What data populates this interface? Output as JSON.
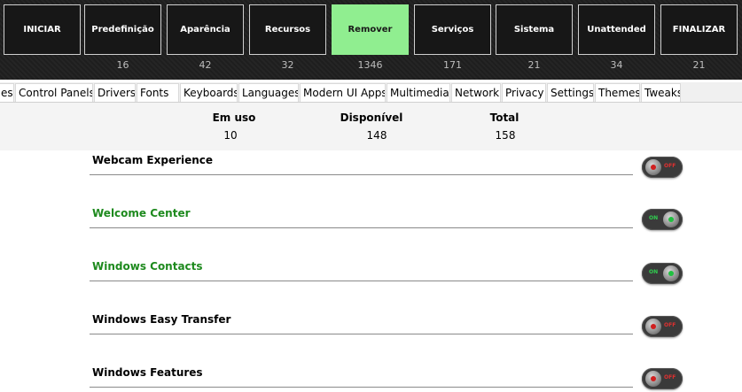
{
  "nav": [
    {
      "label": "INICIAR",
      "count": ""
    },
    {
      "label": "Predefinição",
      "count": "16"
    },
    {
      "label": "Aparência",
      "count": "42"
    },
    {
      "label": "Recursos",
      "count": "32"
    },
    {
      "label": "Remover",
      "count": "1346"
    },
    {
      "label": "Serviços",
      "count": "171"
    },
    {
      "label": "Sistema",
      "count": "21"
    },
    {
      "label": "Unattended",
      "count": "34"
    },
    {
      "label": "FINALIZAR",
      "count": "21"
    }
  ],
  "nav_active": "Remover",
  "tabs": [
    "es",
    "Control Panels",
    "Drivers",
    "Fonts",
    "Keyboards",
    "Languages",
    "Modern UI Apps",
    "Multimedia",
    "Network",
    "Privacy",
    "Settings",
    "Themes",
    "Tweaks"
  ],
  "stats": {
    "in_use_label": "Em uso",
    "in_use_value": "10",
    "available_label": "Disponível",
    "available_value": "148",
    "total_label": "Total",
    "total_value": "158"
  },
  "items": [
    {
      "name": "Webcam Experience",
      "state": "off",
      "toggle_text": "OFF"
    },
    {
      "name": "Welcome Center",
      "state": "on",
      "toggle_text": "ON"
    },
    {
      "name": "Windows Contacts",
      "state": "on",
      "toggle_text": "ON"
    },
    {
      "name": "Windows Easy Transfer",
      "state": "off",
      "toggle_text": "OFF"
    },
    {
      "name": "Windows Features",
      "state": "off",
      "toggle_text": "OFF"
    }
  ],
  "colors": {
    "active_nav": "#90ee90",
    "item_on": "#1e8a1e",
    "item_off": "#000000"
  }
}
